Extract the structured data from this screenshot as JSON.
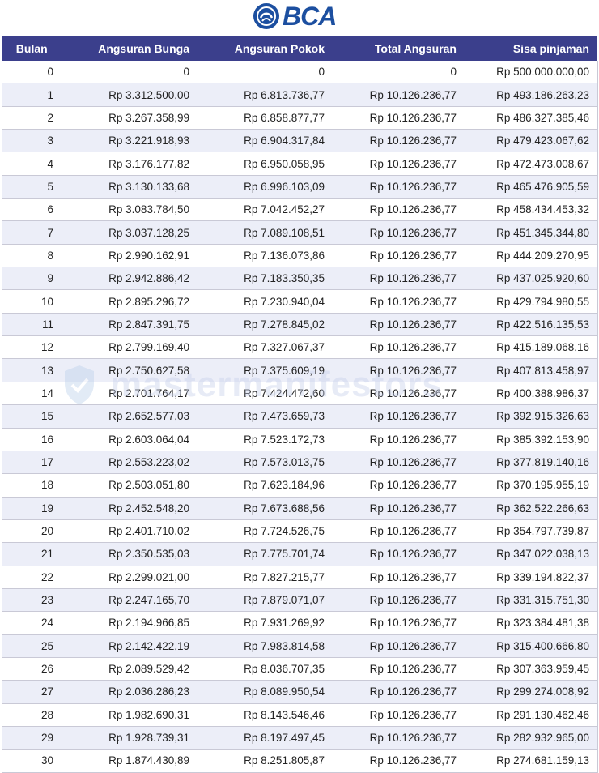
{
  "brand": {
    "name": "BCA",
    "color": "#1c4fa0"
  },
  "watermark": {
    "text": "mastermanifestors"
  },
  "table": {
    "header_color": "#3b3f8c",
    "headers": [
      "Bulan",
      "Angsuran Bunga",
      "Angsuran Pokok",
      "Total Angsuran",
      "Sisa pinjaman"
    ],
    "rows": [
      [
        "0",
        "0",
        "0",
        "0",
        "Rp 500.000.000,00"
      ],
      [
        "1",
        "Rp 3.312.500,00",
        "Rp 6.813.736,77",
        "Rp 10.126.236,77",
        "Rp 493.186.263,23"
      ],
      [
        "2",
        "Rp 3.267.358,99",
        "Rp 6.858.877,77",
        "Rp 10.126.236,77",
        "Rp 486.327.385,46"
      ],
      [
        "3",
        "Rp 3.221.918,93",
        "Rp 6.904.317,84",
        "Rp 10.126.236,77",
        "Rp 479.423.067,62"
      ],
      [
        "4",
        "Rp 3.176.177,82",
        "Rp 6.950.058,95",
        "Rp 10.126.236,77",
        "Rp 472.473.008,67"
      ],
      [
        "5",
        "Rp 3.130.133,68",
        "Rp 6.996.103,09",
        "Rp 10.126.236,77",
        "Rp 465.476.905,59"
      ],
      [
        "6",
        "Rp 3.083.784,50",
        "Rp 7.042.452,27",
        "Rp 10.126.236,77",
        "Rp 458.434.453,32"
      ],
      [
        "7",
        "Rp 3.037.128,25",
        "Rp 7.089.108,51",
        "Rp 10.126.236,77",
        "Rp 451.345.344,80"
      ],
      [
        "8",
        "Rp 2.990.162,91",
        "Rp 7.136.073,86",
        "Rp 10.126.236,77",
        "Rp 444.209.270,95"
      ],
      [
        "9",
        "Rp 2.942.886,42",
        "Rp 7.183.350,35",
        "Rp 10.126.236,77",
        "Rp 437.025.920,60"
      ],
      [
        "10",
        "Rp 2.895.296,72",
        "Rp 7.230.940,04",
        "Rp 10.126.236,77",
        "Rp 429.794.980,55"
      ],
      [
        "11",
        "Rp 2.847.391,75",
        "Rp 7.278.845,02",
        "Rp 10.126.236,77",
        "Rp 422.516.135,53"
      ],
      [
        "12",
        "Rp 2.799.169,40",
        "Rp 7.327.067,37",
        "Rp 10.126.236,77",
        "Rp 415.189.068,16"
      ],
      [
        "13",
        "Rp 2.750.627,58",
        "Rp 7.375.609,19",
        "Rp 10.126.236,77",
        "Rp 407.813.458,97"
      ],
      [
        "14",
        "Rp 2.701.764,17",
        "Rp 7.424.472,60",
        "Rp 10.126.236,77",
        "Rp 400.388.986,37"
      ],
      [
        "15",
        "Rp 2.652.577,03",
        "Rp 7.473.659,73",
        "Rp 10.126.236,77",
        "Rp 392.915.326,63"
      ],
      [
        "16",
        "Rp 2.603.064,04",
        "Rp 7.523.172,73",
        "Rp 10.126.236,77",
        "Rp 385.392.153,90"
      ],
      [
        "17",
        "Rp 2.553.223,02",
        "Rp 7.573.013,75",
        "Rp 10.126.236,77",
        "Rp 377.819.140,16"
      ],
      [
        "18",
        "Rp 2.503.051,80",
        "Rp 7.623.184,96",
        "Rp 10.126.236,77",
        "Rp 370.195.955,19"
      ],
      [
        "19",
        "Rp 2.452.548,20",
        "Rp 7.673.688,56",
        "Rp 10.126.236,77",
        "Rp 362.522.266,63"
      ],
      [
        "20",
        "Rp 2.401.710,02",
        "Rp 7.724.526,75",
        "Rp 10.126.236,77",
        "Rp 354.797.739,87"
      ],
      [
        "21",
        "Rp 2.350.535,03",
        "Rp 7.775.701,74",
        "Rp 10.126.236,77",
        "Rp 347.022.038,13"
      ],
      [
        "22",
        "Rp 2.299.021,00",
        "Rp 7.827.215,77",
        "Rp 10.126.236,77",
        "Rp 339.194.822,37"
      ],
      [
        "23",
        "Rp 2.247.165,70",
        "Rp 7.879.071,07",
        "Rp 10.126.236,77",
        "Rp 331.315.751,30"
      ],
      [
        "24",
        "Rp 2.194.966,85",
        "Rp 7.931.269,92",
        "Rp 10.126.236,77",
        "Rp 323.384.481,38"
      ],
      [
        "25",
        "Rp 2.142.422,19",
        "Rp 7.983.814,58",
        "Rp 10.126.236,77",
        "Rp 315.400.666,80"
      ],
      [
        "26",
        "Rp 2.089.529,42",
        "Rp 8.036.707,35",
        "Rp 10.126.236,77",
        "Rp 307.363.959,45"
      ],
      [
        "27",
        "Rp 2.036.286,23",
        "Rp 8.089.950,54",
        "Rp 10.126.236,77",
        "Rp 299.274.008,92"
      ],
      [
        "28",
        "Rp 1.982.690,31",
        "Rp 8.143.546,46",
        "Rp 10.126.236,77",
        "Rp 291.130.462,46"
      ],
      [
        "29",
        "Rp 1.928.739,31",
        "Rp 8.197.497,45",
        "Rp 10.126.236,77",
        "Rp 282.932.965,00"
      ],
      [
        "30",
        "Rp 1.874.430,89",
        "Rp 8.251.805,87",
        "Rp 10.126.236,77",
        "Rp 274.681.159,13"
      ]
    ]
  }
}
